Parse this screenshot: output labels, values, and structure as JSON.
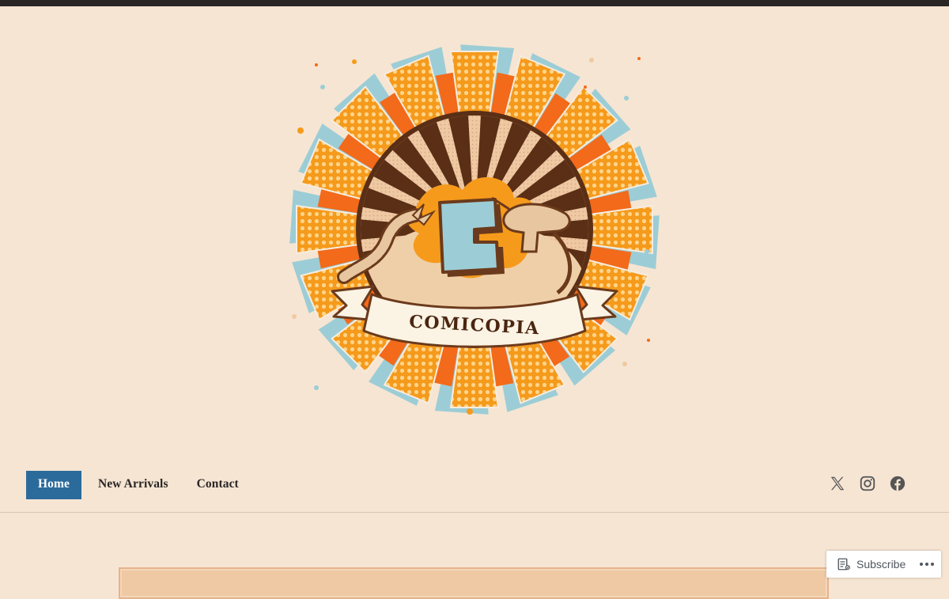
{
  "site": {
    "logo_text": "COMICOPIA"
  },
  "nav": {
    "items": [
      {
        "label": "Home",
        "active": true
      },
      {
        "label": "New Arrivals",
        "active": false
      },
      {
        "label": "Contact",
        "active": false
      }
    ]
  },
  "social": {
    "icons": [
      "x-icon",
      "instagram-icon",
      "facebook-icon"
    ]
  },
  "subscribe": {
    "label": "Subscribe"
  },
  "colors": {
    "background": "#f6e5d3",
    "topbar": "#2a2626",
    "nav_active": "#2b6b9b",
    "logo_orange": "#f59a1b",
    "logo_red": "#f26a1a",
    "logo_blue": "#9ccdd6",
    "logo_brown": "#5a2f16"
  }
}
